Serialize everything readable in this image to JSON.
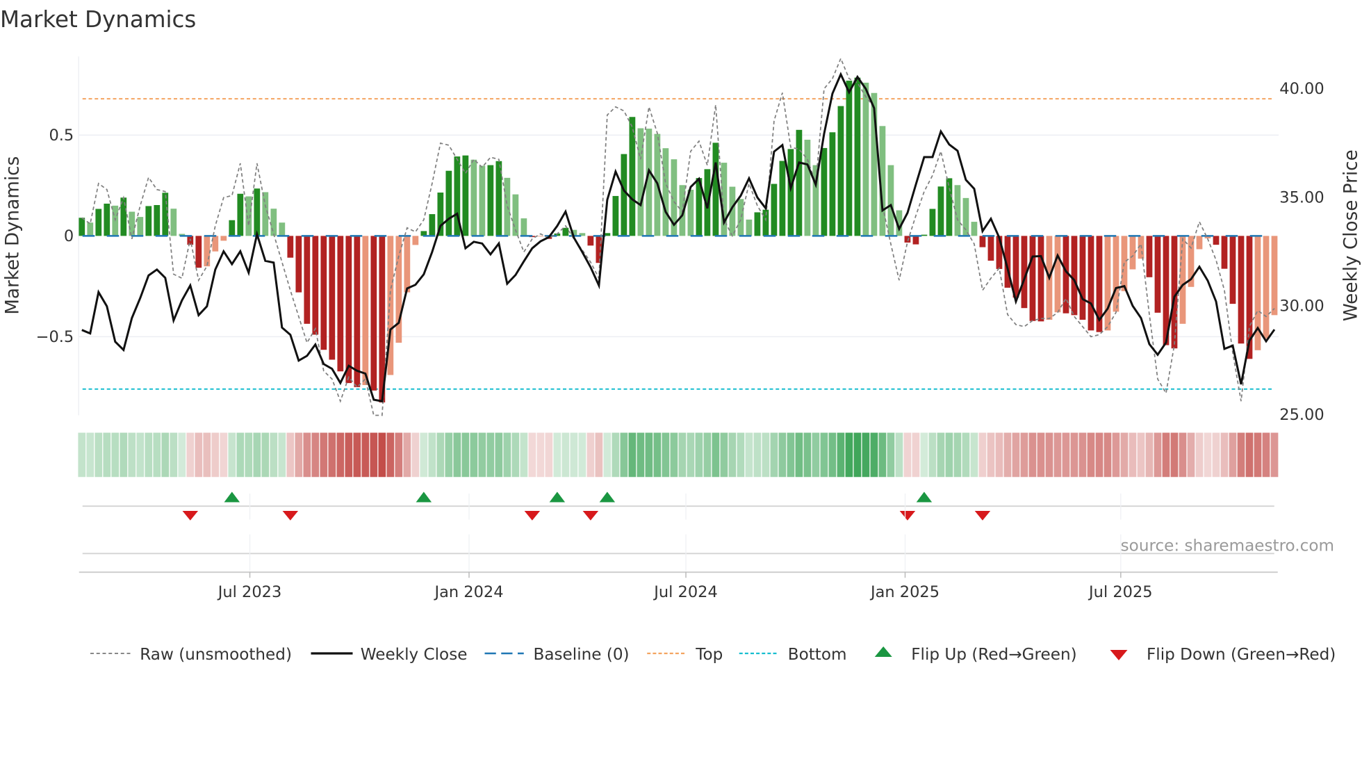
{
  "page": {
    "title": "Market Dynamics",
    "source": "source: sharemaestro.com"
  },
  "legend": {
    "raw": "Raw (unsmoothed)",
    "close": "Weekly Close",
    "baseline": "Baseline (0)",
    "top": "Top",
    "bottom": "Bottom",
    "flip_up": "Flip Up (Red→Green)",
    "flip_down": "Flip Down (Green→Red)"
  },
  "colors": {
    "green_strong": "#228b22",
    "green_weak": "#80bf80",
    "red_strong": "#b22222",
    "red_weak": "#e9967a",
    "baseline": "#1f77b4",
    "top": "#f4a460",
    "bottom": "#17becf",
    "raw": "#808080",
    "close": "#111111",
    "flip_up": "#1a9641",
    "flip_down": "#d7191c"
  },
  "chart_data": {
    "type": "bar",
    "title": "Market Dynamics",
    "ylabel": "Market Dynamics",
    "y2label": "Weekly Close Price",
    "ylim": [
      -0.89,
      0.89
    ],
    "y2lim": [
      24.92,
      41.44
    ],
    "yticks": [
      {
        "v": 0.5,
        "label": "0.5"
      },
      {
        "v": 0,
        "label": "0"
      },
      {
        "v": -0.5,
        "label": "−0.5"
      }
    ],
    "y2ticks": [
      {
        "v": 40,
        "label": "40.00"
      },
      {
        "v": 35,
        "label": "35.00"
      },
      {
        "v": 30,
        "label": "30.00"
      },
      {
        "v": 25,
        "label": "25.00"
      }
    ],
    "xticks": [
      {
        "date": "2023-07-01",
        "label": "Jul 2023"
      },
      {
        "date": "2024-01-01",
        "label": "Jan 2024"
      },
      {
        "date": "2024-07-01",
        "label": "Jul 2024"
      },
      {
        "date": "2025-01-01",
        "label": "Jan 2025"
      },
      {
        "date": "2025-07-01",
        "label": "Jul 2025"
      }
    ],
    "start_date": "2023-02-10",
    "frequency": "weekly",
    "baseline": 0,
    "top_threshold": 0.68,
    "bottom_threshold": -0.76,
    "grid": true,
    "legend_position": "bottom",
    "dynamics": [
      0.09,
      0.066,
      0.134,
      0.16,
      0.15,
      0.19,
      0.12,
      0.094,
      0.148,
      0.153,
      0.214,
      0.135,
      0.01,
      -0.044,
      -0.158,
      -0.151,
      -0.077,
      -0.024,
      0.078,
      0.209,
      0.196,
      0.235,
      0.217,
      0.135,
      0.066,
      -0.108,
      -0.28,
      -0.436,
      -0.49,
      -0.565,
      -0.614,
      -0.672,
      -0.73,
      -0.75,
      -0.74,
      -0.767,
      -0.826,
      -0.69,
      -0.53,
      -0.28,
      -0.045,
      0.024,
      0.108,
      0.215,
      0.323,
      0.394,
      0.399,
      0.378,
      0.348,
      0.351,
      0.371,
      0.288,
      0.206,
      0.087,
      -0.006,
      -0.003,
      -0.015,
      0.012,
      0.04,
      0.03,
      0.014,
      -0.048,
      -0.134,
      0.014,
      0.198,
      0.406,
      0.59,
      0.534,
      0.532,
      0.506,
      0.435,
      0.38,
      0.252,
      0.229,
      0.287,
      0.331,
      0.462,
      0.363,
      0.244,
      0.183,
      0.081,
      0.117,
      0.13,
      0.258,
      0.372,
      0.431,
      0.526,
      0.477,
      0.351,
      0.436,
      0.514,
      0.644,
      0.77,
      0.785,
      0.76,
      0.709,
      0.545,
      0.351,
      0.127,
      -0.033,
      -0.042,
      0.006,
      0.134,
      0.245,
      0.286,
      0.252,
      0.188,
      0.07,
      -0.056,
      -0.123,
      -0.164,
      -0.257,
      -0.306,
      -0.358,
      -0.422,
      -0.424,
      -0.416,
      -0.379,
      -0.384,
      -0.393,
      -0.416,
      -0.469,
      -0.477,
      -0.469,
      -0.376,
      -0.274,
      -0.166,
      -0.113,
      -0.205,
      -0.381,
      -0.542,
      -0.558,
      -0.436,
      -0.253,
      -0.066,
      -0.012,
      -0.044,
      -0.163,
      -0.337,
      -0.534,
      -0.61,
      -0.567,
      -0.509,
      -0.393
    ],
    "raw": [
      0.09,
      0.06,
      0.26,
      0.23,
      0.08,
      0.19,
      -0.015,
      0.15,
      0.29,
      0.23,
      0.22,
      -0.19,
      -0.21,
      -0.015,
      -0.22,
      -0.15,
      0.05,
      0.19,
      0.2,
      0.36,
      0.05,
      0.36,
      0.15,
      0.01,
      -0.13,
      -0.27,
      -0.4,
      -0.53,
      -0.46,
      -0.67,
      -0.71,
      -0.82,
      -0.7,
      -0.75,
      -0.71,
      -0.89,
      -0.89,
      -0.27,
      -0.1,
      0.04,
      0.02,
      0.08,
      0.26,
      0.46,
      0.45,
      0.38,
      0.31,
      0.38,
      0.34,
      0.39,
      0.38,
      0.15,
      0.03,
      -0.08,
      -0.015,
      0.01,
      -0.01,
      0.01,
      0.05,
      -0.015,
      -0.07,
      -0.13,
      -0.21,
      0.6,
      0.64,
      0.62,
      0.54,
      0.38,
      0.64,
      0.51,
      0.26,
      0.17,
      0.12,
      0.42,
      0.47,
      0.35,
      0.65,
      0.08,
      0,
      0.08,
      0.26,
      0.15,
      0.08,
      0.57,
      0.71,
      0.44,
      0.43,
      0.38,
      0.26,
      0.73,
      0.78,
      0.88,
      0.78,
      0.76,
      0.69,
      0.64,
      0.15,
      -0.04,
      -0.22,
      -0.03,
      0.1,
      0.22,
      0.3,
      0.42,
      0.24,
      0.08,
      0.03,
      -0.04,
      -0.27,
      -0.21,
      -0.16,
      -0.39,
      -0.44,
      -0.45,
      -0.42,
      -0.41,
      -0.41,
      -0.38,
      -0.31,
      -0.4,
      -0.45,
      -0.5,
      -0.49,
      -0.45,
      -0.38,
      -0.13,
      -0.1,
      -0.04,
      -0.39,
      -0.71,
      -0.78,
      -0.54,
      -0.015,
      -0.06,
      0.07,
      -0.015,
      -0.12,
      -0.27,
      -0.58,
      -0.82,
      -0.45,
      -0.37,
      -0.4,
      -0.36
    ],
    "close": [
      28.85,
      28.69,
      30.59,
      29.94,
      28.31,
      27.93,
      29.4,
      30.32,
      31.36,
      31.63,
      31.25,
      29.29,
      30.21,
      30.9,
      29.53,
      29.94,
      31.63,
      32.47,
      31.88,
      32.47,
      31.49,
      33.26,
      32.03,
      31.95,
      28.96,
      28.63,
      27.44,
      27.66,
      28.18,
      27.28,
      27.06,
      26.41,
      27.2,
      26.97,
      26.84,
      25.64,
      25.57,
      28.87,
      29.18,
      30.76,
      30.93,
      31.41,
      32.44,
      33.64,
      33.97,
      34.2,
      32.61,
      32.91,
      32.83,
      32.33,
      32.83,
      30.98,
      31.38,
      32.01,
      32.61,
      32.93,
      33.12,
      33.64,
      34.3,
      33.1,
      32.44,
      31.74,
      30.9,
      34.84,
      36.14,
      35.27,
      34.86,
      34.6,
      36.2,
      35.6,
      34.29,
      33.69,
      34.13,
      35.43,
      35.81,
      34.45,
      36.56,
      33.8,
      34.5,
      35.03,
      35.83,
      34.95,
      34.45,
      37.06,
      37.36,
      35.38,
      36.56,
      36.47,
      35.54,
      37.88,
      39.73,
      40.62,
      39.79,
      40.5,
      39.95,
      39.06,
      34.35,
      34.6,
      33.5,
      34.24,
      35.54,
      36.81,
      36.81,
      37.99,
      37.39,
      37.1,
      35.76,
      35.35,
      33.4,
      33.97,
      33.1,
      31.68,
      30.16,
      31.19,
      32.23,
      32.25,
      31.25,
      32.28,
      31.55,
      31.14,
      30.27,
      30.07,
      29.31,
      29.83,
      30.78,
      30.87,
      29.96,
      29.4,
      28.2,
      27.71,
      28.27,
      30.38,
      30.92,
      31.19,
      31.76,
      31.12,
      30.16,
      27.98,
      28.13,
      26.35,
      28.36,
      28.94,
      28.33,
      28.87
    ],
    "flip_up": [
      18,
      41,
      57,
      63,
      101
    ],
    "flip_down": [
      13,
      25,
      54,
      61,
      99,
      108
    ]
  }
}
